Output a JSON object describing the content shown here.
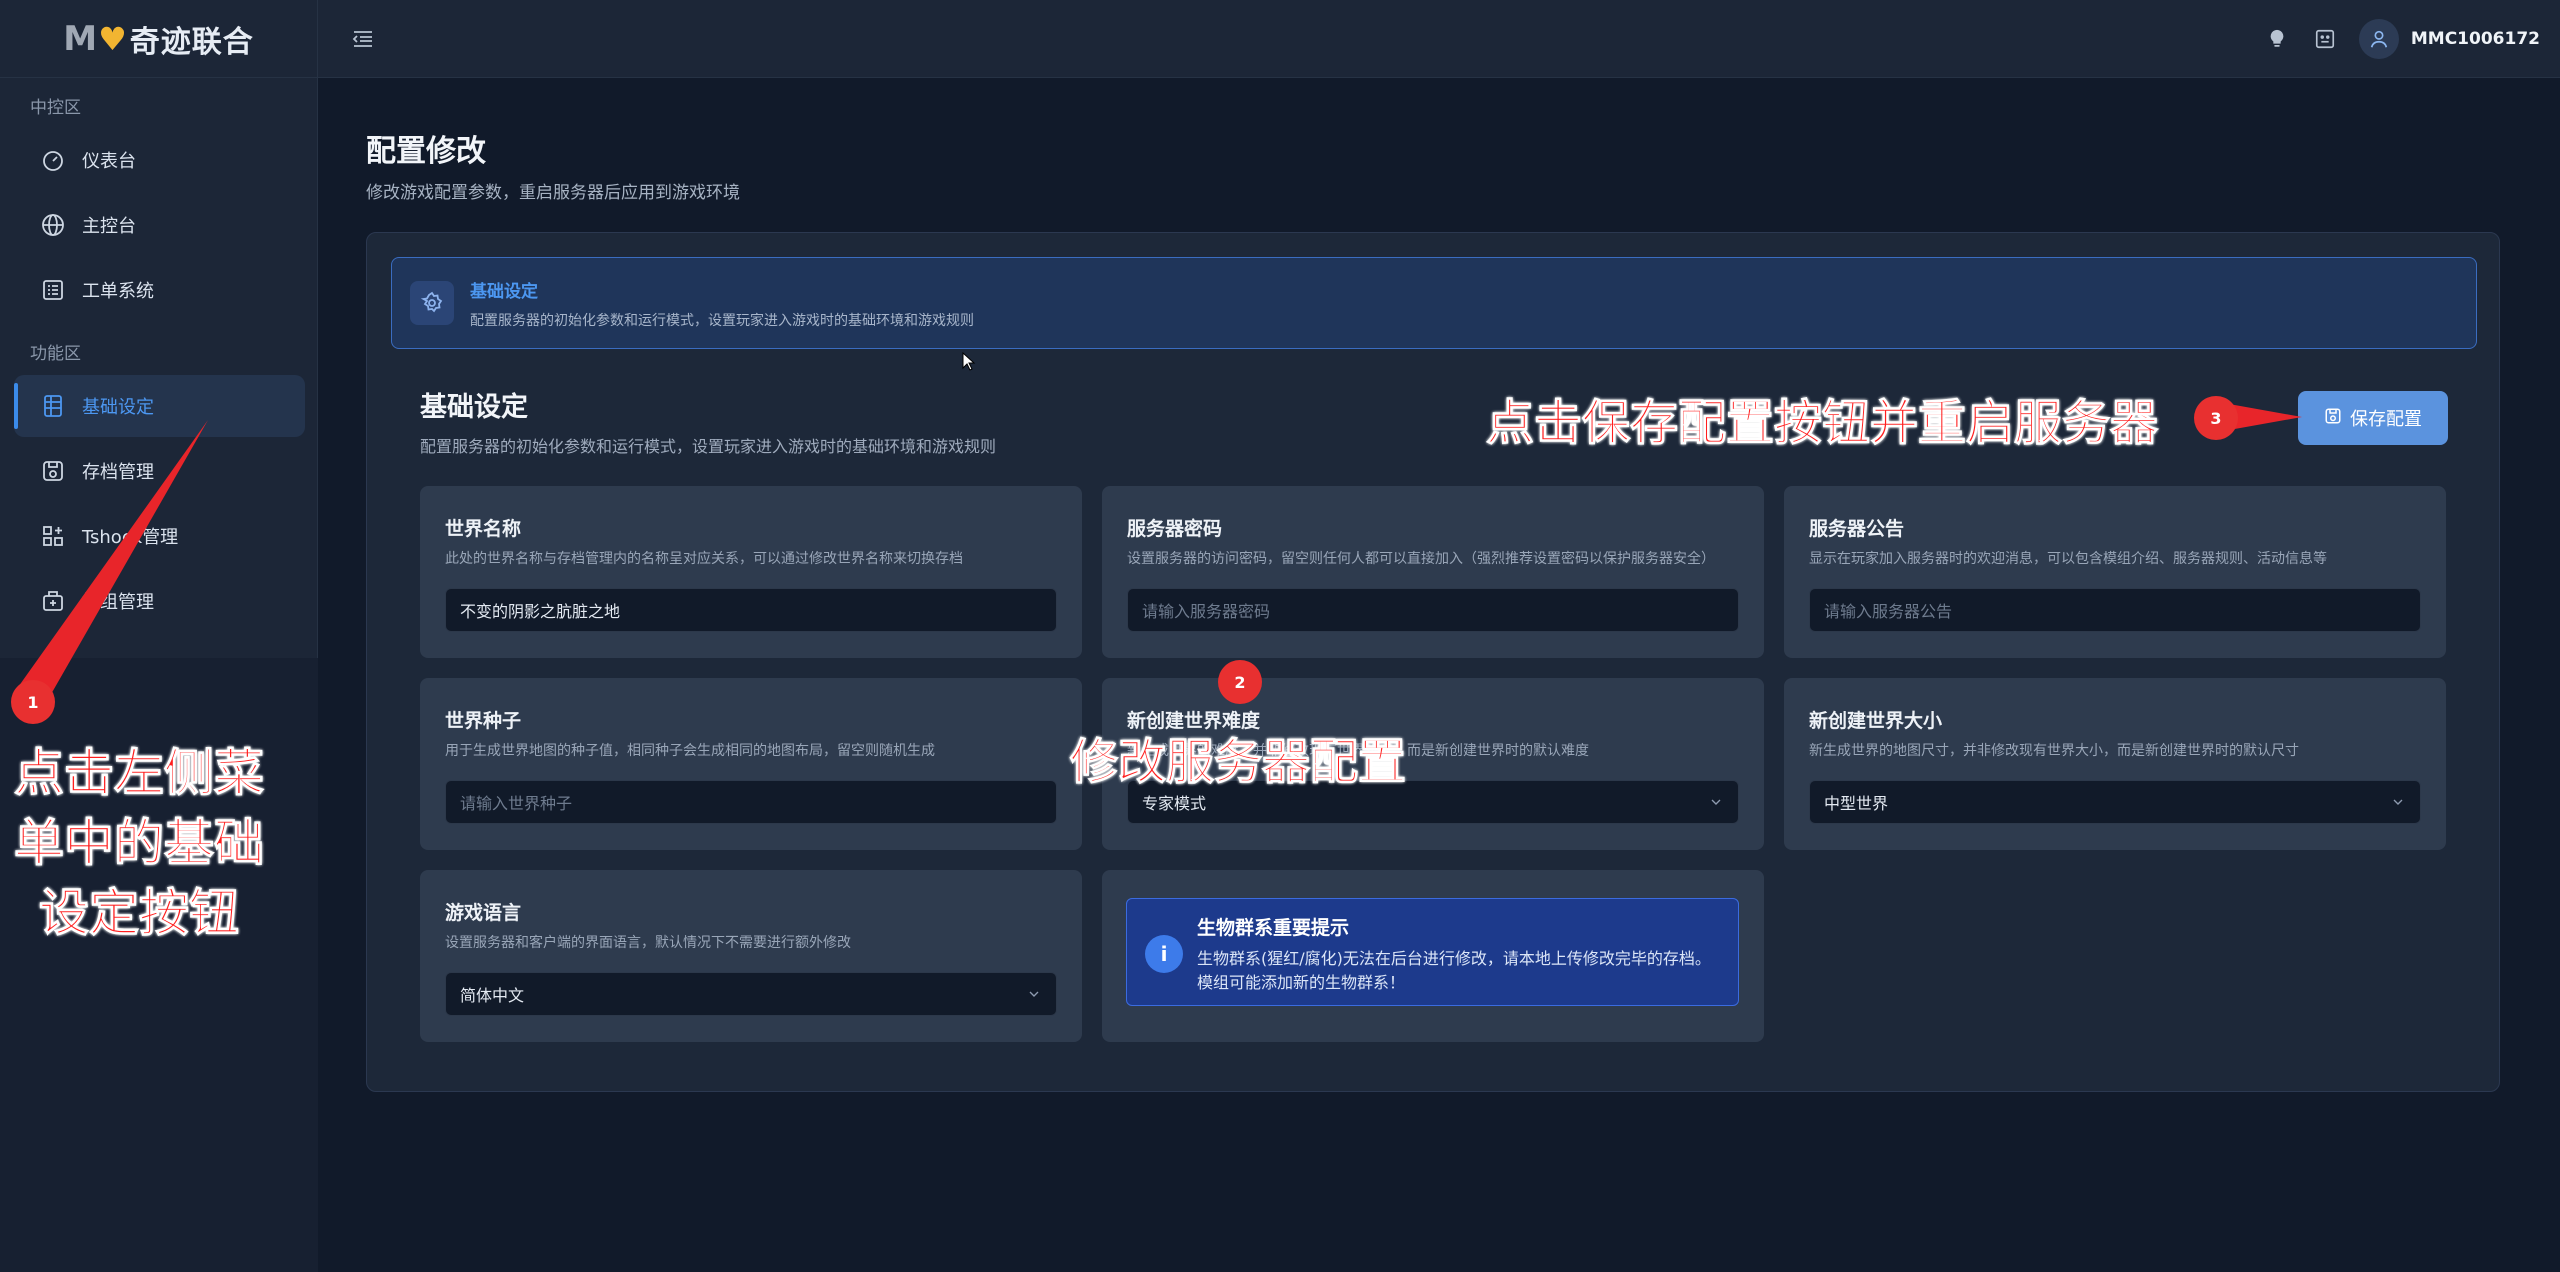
{
  "app": {
    "logo_prefix": "MV",
    "logo_text": "奇迹联合"
  },
  "sidebar": {
    "groups": [
      {
        "label": "中控区",
        "items": [
          {
            "label": "仪表台",
            "icon": "dashboard-icon"
          },
          {
            "label": "主控台",
            "icon": "globe-icon"
          },
          {
            "label": "工单系统",
            "icon": "list-icon"
          }
        ]
      },
      {
        "label": "功能区",
        "items": [
          {
            "label": "基础设定",
            "icon": "table-icon",
            "active": true
          },
          {
            "label": "存档管理",
            "icon": "save-icon"
          },
          {
            "label": "Tshock管理",
            "icon": "grid-icon"
          },
          {
            "label": "模组管理",
            "icon": "plugin-icon"
          }
        ]
      }
    ]
  },
  "topbar": {
    "username": "MMC1006172",
    "icons": [
      "bulb-icon",
      "face-icon",
      "user-icon"
    ]
  },
  "page": {
    "title": "配置修改",
    "subtitle": "修改游戏配置参数，重启服务器后应用到游戏环境"
  },
  "banner": {
    "title": "基础设定",
    "desc": "配置服务器的初始化参数和运行模式，设置玩家进入游戏时的基础环境和游戏规则"
  },
  "section": {
    "title": "基础设定",
    "desc": "配置服务器的初始化参数和运行模式，设置玩家进入游戏时的基础环境和游戏规则",
    "save_label": "保存配置"
  },
  "fields": {
    "world_name": {
      "label": "世界名称",
      "desc": "此处的世界名称与存档管理内的名称呈对应关系，可以通过修改世界名称来切换存档",
      "value": "不变的阴影之肮脏之地"
    },
    "server_password": {
      "label": "服务器密码",
      "desc": "设置服务器的访问密码，留空则任何人都可以直接加入（强烈推荐设置密码以保护服务器安全）",
      "placeholder": "请输入服务器密码"
    },
    "server_notice": {
      "label": "服务器公告",
      "desc": "显示在玩家加入服务器时的欢迎消息，可以包含模组介绍、服务器规则、活动信息等",
      "placeholder": "请输入服务器公告"
    },
    "world_seed": {
      "label": "世界种子",
      "desc": "用于生成世界地图的种子值，相同种子会生成相同的地图布局，留空则随机生成",
      "placeholder": "请输入世界种子"
    },
    "difficulty": {
      "label": "新创建世界难度",
      "desc": "新生成世界的难度，并非修改现有世界难度，而是新创建世界时的默认难度",
      "value": "专家模式"
    },
    "world_size": {
      "label": "新创建世界大小",
      "desc": "新生成世界的地图尺寸，并非修改现有世界大小，而是新创建世界时的默认尺寸",
      "value": "中型世界"
    },
    "language": {
      "label": "游戏语言",
      "desc": "设置服务器和客户端的界面语言，默认情况下不需要进行额外修改",
      "value": "简体中文"
    }
  },
  "alert": {
    "title": "生物群系重要提示",
    "text": "生物群系(猩红/腐化)无法在后台进行修改，请本地上传修改完毕的存档。模组可能添加新的生物群系！"
  },
  "annotations": {
    "step1_badge": "1",
    "step1_text_line1": "点击左侧菜",
    "step1_text_line2": "单中的基础",
    "step1_text_line3": "设定按钮",
    "step2_badge": "2",
    "step2_text": "修改服务器配置",
    "step3_badge": "3",
    "step3_text": "点击保存配置按钮并重启服务器",
    "color": "#ff1e1e"
  }
}
